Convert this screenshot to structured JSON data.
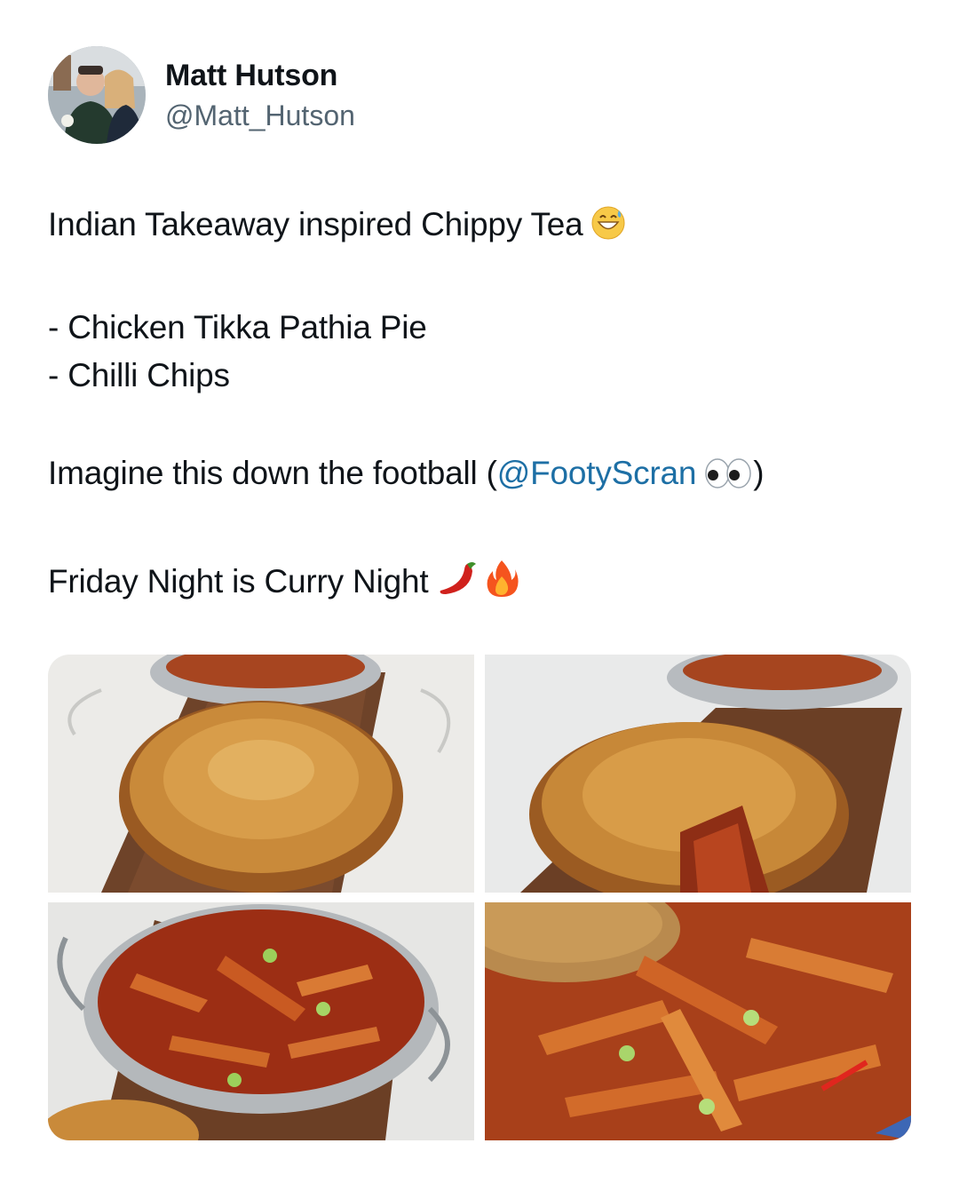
{
  "author": {
    "display_name": "Matt Hutson",
    "handle": "@Matt_Hutson"
  },
  "tweet": {
    "line1": "Indian Takeaway inspired Chippy Tea",
    "line1_emoji": "grinning-sweat-emoji",
    "list_item_1": "- Chicken Tikka Pathia Pie",
    "list_item_2": "- Chilli Chips",
    "line3_before": "Imagine this down the football (",
    "line3_mention": "@FootyScran",
    "line3_emoji": "eyes-emoji",
    "line3_after": ")",
    "line4": "Friday Night is Curry Night",
    "line4_emojis": [
      "chilli-pepper-emoji",
      "fire-emoji"
    ]
  },
  "colors": {
    "text": "#0f1419",
    "secondary": "#536471",
    "mention": "#1d6fa5"
  },
  "media": {
    "count": 4,
    "photos": [
      {
        "subject": "pie-and-chips-on-board-photo"
      },
      {
        "subject": "cut-pie-on-board-photo"
      },
      {
        "subject": "chilli-chips-bowl-photo"
      },
      {
        "subject": "chilli-chips-closeup-photo"
      }
    ]
  }
}
